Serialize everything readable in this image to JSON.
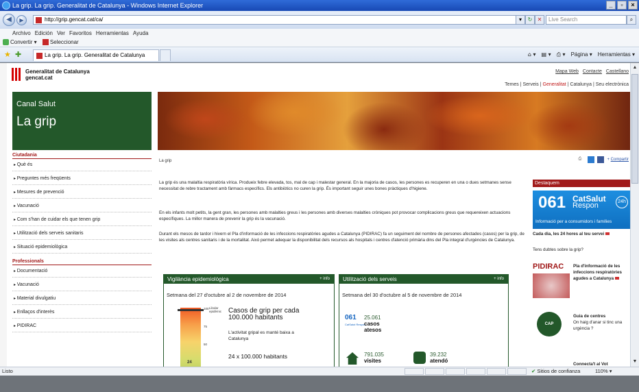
{
  "browser": {
    "title": "La grip. La grip. Generalitat de Catalunya - Windows Internet Explorer",
    "url": "http://grip.gencat.cat/ca/",
    "search_placeholder": "Live Search",
    "menu": [
      "Archivo",
      "Edición",
      "Ver",
      "Favoritos",
      "Herramientas",
      "Ayuda"
    ],
    "links": {
      "convert": "Convertir",
      "select": "Seleccionar"
    },
    "tab_title": "La grip. La grip. Generalitat de Catalunya",
    "cmd": {
      "page": "Página",
      "tools": "Herramientas"
    },
    "status": "Listo",
    "trust": "Sitios de confianza",
    "zoom": "110%"
  },
  "site": {
    "brand_line1": "Generalitat de Catalunya",
    "brand_line2": "gencat.cat",
    "top_links": [
      "Mapa Web",
      "Contacte",
      "Castellano"
    ],
    "sub_links": {
      "a": "Temes",
      "b": "Serveis",
      "c": "Generalitat",
      "d": "Catalunya",
      "e": "Seu electrònica"
    },
    "hero_small": "Canal Salut",
    "hero_big": "La grip"
  },
  "nav": {
    "ciutadania": "Ciutadania",
    "ciutadania_items": [
      "Què és",
      "Preguntes més freqüents",
      "Mesures de prevenció",
      "Vacunació",
      "Com s'han de cuidar els que tenen grip",
      "Utilització dels serveis sanitaris",
      "Situació epidemiològica"
    ],
    "professionals": "Professionals",
    "professionals_items": [
      "Documentació",
      "Vacunació",
      "Material divulgatiu",
      "Enllaços d'interès",
      "PIDIRAC"
    ]
  },
  "main": {
    "breadcrumb": "La grip",
    "share": "Compartir",
    "p1": "La grip és una malaltia respiratòria vírica. Produeix febre elevada, tos, mal de cap i malestar general. En la majoria de casos, les persones es recuperen en una o dues setmanes sense necessitat de rebre tractament amb fàrmacs específics. Els antibiòtics no curen la grip. És important seguir unes bones pràctiques d'higiene.",
    "p2": "En els infants molt petits, la gent gran, les persones amb malalties greus i les persones amb diverses malalties cròniques pot provocar complicacions greus que requereixen actuacions específiques. La millor manera de prevenir la grip és la vacunació.",
    "p3": "Durant els mesos de tardor i hivern el Pla d'informació de les infeccions respiratòries agudes a Catalunya (PIDIRAC) fa un seguiment del nombre de persones afectades (casos) per la grip, de les visites als centres sanitaris i de la mortalitat. Això permet adequar la disponibilitat dels recursos als hospitals i centres d'atenció primària dins del Pla integral d'urgències de Catalunya."
  },
  "vigilancia": {
    "title": "Vigilància epidemiològica",
    "more": "+ info",
    "week": "Setmana del 27 d'octubre al 2 de novembre de 2014",
    "cases_head": "Casos de grip per cada 100.000 habitants",
    "threshold_label": "Llindar epidèmic",
    "scale": [
      "100",
      "75",
      "50",
      "24"
    ],
    "text": "L'activitat gripal es manté baixa a Catalunya",
    "rate": "24 x 100.000 habitants"
  },
  "utilitzacio": {
    "title": "Utilització dels serveis",
    "more": "+ info",
    "week": "Setmana del 30 d'octubre al 5 de novembre de 2014",
    "n061": "061",
    "n061_sub": "CatSalut Respon",
    "calls": "25.061",
    "calls_label1": "casos",
    "calls_label2": "atesos",
    "visits": "791.035",
    "visits_label": "visites",
    "attended": "39.232",
    "attended_label": "atendó"
  },
  "sidebar": {
    "header": "Destaquem",
    "banner_num": "061",
    "banner_cs": "CatSalut",
    "banner_rp": "Respon",
    "banner_circle": "24h",
    "banner_info": "Informació per a consumidors i famílies",
    "t1": "Cada dia, les 24 hores al teu servei",
    "t2": "Tens dubtes sobre la grip?",
    "pidirac": "PIDIRAC",
    "pidirac_text": "Pla d'informació de les infeccions respiratòries agudes a Catalunya",
    "cap_logo": "CAP",
    "centres_head": "Guia de centres",
    "centres_text": "On haig d'anar si tinc una urgència ?",
    "connect": "Connecta't al Vot"
  },
  "colors": {
    "brand_green": "#23582a",
    "brand_red": "#a11a1a",
    "ie_blue": "#1849b4"
  },
  "icons": [
    "ie-logo-icon",
    "back-icon",
    "forward-icon",
    "refresh-icon",
    "stop-icon",
    "search-icon",
    "favorites-star-icon",
    "home-icon",
    "print-icon",
    "facebook-icon",
    "twitter-icon"
  ]
}
